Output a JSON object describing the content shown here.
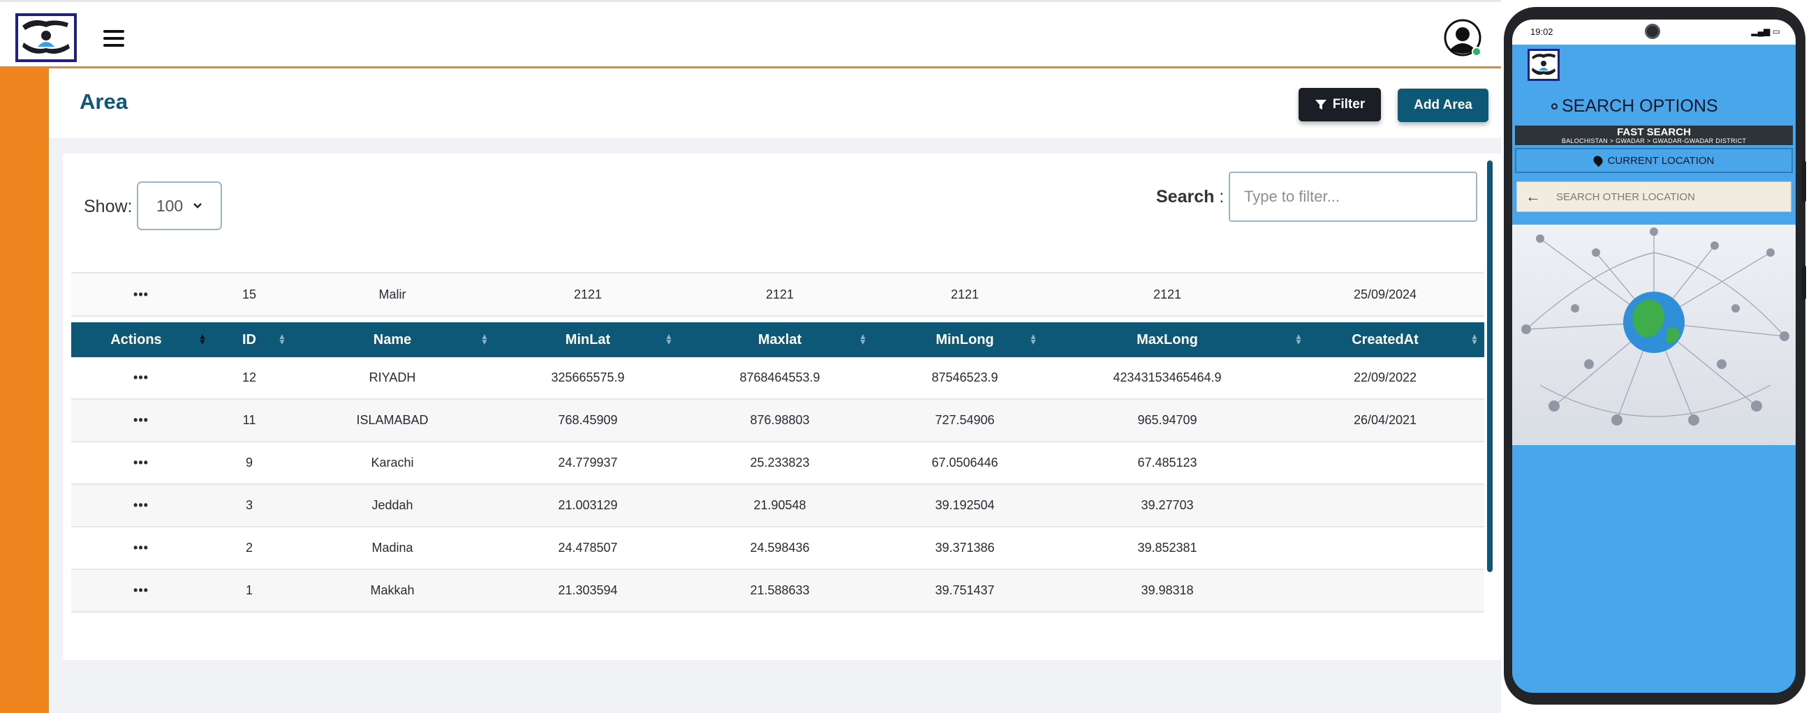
{
  "page": {
    "title": "Area"
  },
  "header": {
    "menu_icon": "hamburger-icon",
    "avatar_icon": "user-avatar-icon"
  },
  "toolbar": {
    "filter_label": "Filter",
    "add_label": "Add Area"
  },
  "controls": {
    "show_label": "Show:",
    "show_value": "100",
    "search_label": "Search",
    "search_colon": ":",
    "search_placeholder": "Type to filter..."
  },
  "filter_row": {
    "actions": "•••",
    "id": "15",
    "name": "Malir",
    "minlat": "2121",
    "maxlat": "2121",
    "minlong": "2121",
    "maxlong": "2121",
    "createdat": "25/09/2024"
  },
  "columns": [
    "Actions",
    "ID",
    "Name",
    "MinLat",
    "Maxlat",
    "MinLong",
    "MaxLong",
    "CreatedAt"
  ],
  "rows": [
    {
      "actions": "•••",
      "id": "12",
      "name": "RIYADH",
      "minlat": "325665575.9",
      "maxlat": "8768464553.9",
      "minlong": "87546523.9",
      "maxlong": "42343153465464.9",
      "createdat": "22/09/2022"
    },
    {
      "actions": "•••",
      "id": "11",
      "name": "ISLAMABAD",
      "minlat": "768.45909",
      "maxlat": "876.98803",
      "minlong": "727.54906",
      "maxlong": "965.94709",
      "createdat": "26/04/2021"
    },
    {
      "actions": "•••",
      "id": "9",
      "name": "Karachi",
      "minlat": "24.779937",
      "maxlat": "25.233823",
      "minlong": "67.0506446",
      "maxlong": "67.485123",
      "createdat": ""
    },
    {
      "actions": "•••",
      "id": "3",
      "name": "Jeddah",
      "minlat": "21.003129",
      "maxlat": "21.90548",
      "minlong": "39.192504",
      "maxlong": "39.27703",
      "createdat": ""
    },
    {
      "actions": "•••",
      "id": "2",
      "name": "Madina",
      "minlat": "24.478507",
      "maxlat": "24.598436",
      "minlong": "39.371386",
      "maxlong": "39.852381",
      "createdat": ""
    },
    {
      "actions": "•••",
      "id": "1",
      "name": "Makkah",
      "minlat": "21.303594",
      "maxlat": "21.588633",
      "minlong": "39.751437",
      "maxlong": "39.98318",
      "createdat": ""
    }
  ],
  "phone": {
    "time": "19:02",
    "search_options": "SEARCH OPTIONS",
    "fast_search": "FAST SEARCH",
    "location_path": "BALOCHISTAN > GWADAR > GWADAR-GWADAR DISTRICT",
    "current_location": "CURRENT LOCATION",
    "other_location_placeholder": "SEARCH OTHER LOCATION"
  },
  "colors": {
    "brand": "#0d5876",
    "accent": "#f0851f",
    "phone_blue": "#4aa6ea"
  }
}
